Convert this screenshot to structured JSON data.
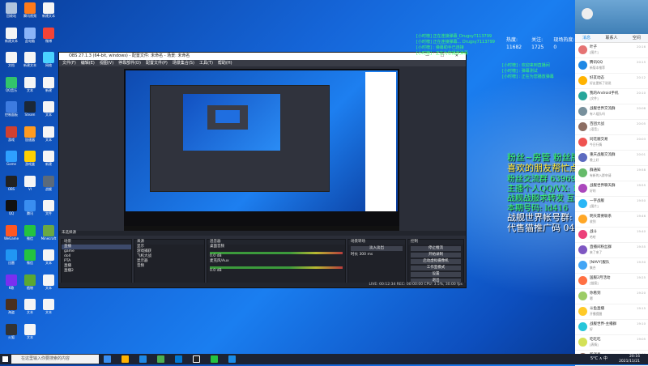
{
  "desktop_icons": [
    {
      "label": "回收站",
      "color": "#b0c4de"
    },
    {
      "label": "腾讯视频",
      "color": "#ff7a1a"
    },
    {
      "label": "新建文本",
      "color": "#f5f5f5"
    },
    {
      "label": "新建文本",
      "color": "#f5f5f5"
    },
    {
      "label": "此电脑",
      "color": "#8ab4f8"
    },
    {
      "label": "微博",
      "color": "#f44336"
    },
    {
      "label": "文档",
      "color": "#f5f5f5"
    },
    {
      "label": "新建文本",
      "color": "#f5f5f5"
    },
    {
      "label": "网络",
      "color": "#4ad2ff"
    },
    {
      "label": "QQ音乐",
      "color": "#32c46b"
    },
    {
      "label": "文本",
      "color": "#f5f5f5"
    },
    {
      "label": "新建",
      "color": "#f5f5f5"
    },
    {
      "label": "控制面板",
      "color": "#3d7be0"
    },
    {
      "label": "Steam",
      "color": "#1b2838"
    },
    {
      "label": "文本",
      "color": "#f5f5f5"
    },
    {
      "label": "游戏",
      "color": "#d04030"
    },
    {
      "label": "加速器",
      "color": "#ff9b20"
    },
    {
      "label": "文本",
      "color": "#f5f5f5"
    },
    {
      "label": "Game",
      "color": "#2ea0ff"
    },
    {
      "label": "游戏盒",
      "color": "#ffd000"
    },
    {
      "label": "新建",
      "color": "#f5f5f5"
    },
    {
      "label": "OBS",
      "color": "#222"
    },
    {
      "label": "VI",
      "color": "#f5f5f5"
    },
    {
      "label": "战舰",
      "color": "#5b6a7a"
    },
    {
      "label": "QQ",
      "color": "#111"
    },
    {
      "label": "腾讯",
      "color": "#3a8ef0"
    },
    {
      "label": "文件",
      "color": "#f5f5f5"
    },
    {
      "label": "WeGame",
      "color": "#ff5722"
    },
    {
      "label": "微信",
      "color": "#24c340"
    },
    {
      "label": "Minecraft",
      "color": "#6aa843"
    },
    {
      "label": "迅雷",
      "color": "#2196f3"
    },
    {
      "label": "微信",
      "color": "#24c340"
    },
    {
      "label": "文本",
      "color": "#f5f5f5"
    },
    {
      "label": "K歌",
      "color": "#7a2ff0"
    },
    {
      "label": "植物",
      "color": "#5aa832"
    },
    {
      "label": "文本",
      "color": "#f5f5f5"
    },
    {
      "label": "海盗",
      "color": "#4a3020"
    },
    {
      "label": "文本",
      "color": "#f5f5f5"
    },
    {
      "label": "文本",
      "color": "#f5f5f5"
    },
    {
      "label": "火狐",
      "color": "#333"
    },
    {
      "label": "文本",
      "color": "#f5f5f5"
    }
  ],
  "obs": {
    "title": "OBS 27.1.3 (64-bit, windows) - 配置文件: 未命名 - 场景: 未命名",
    "window_controls": "—  ☐  ✕",
    "menu": [
      "文件(F)",
      "编辑(E)",
      "视图(V)",
      "停靠部件(D)",
      "配置文件(P)",
      "场景集合(S)",
      "工具(T)",
      "帮助(H)"
    ],
    "source_label": "未选择源",
    "panels": {
      "scenes": {
        "header": "场景",
        "items": [
          "直播",
          "game",
          "doll",
          "PTA",
          "直播",
          "直播2"
        ]
      },
      "sources": {
        "header": "来源",
        "items": [
          "显示",
          "游戏捕获",
          "飞机大战",
          "显示器",
          "音频"
        ]
      },
      "mixer": {
        "header": "混音器",
        "channels": [
          "桌面音频",
          "麦克风/Aux"
        ],
        "levels": [
          "0.0 dB",
          "0.0 dB"
        ]
      },
      "transitions": {
        "header": "场景转场",
        "type": "淡入淡出",
        "duration_label": "时长",
        "duration": "300 ms"
      },
      "controls": {
        "header": "控制",
        "buttons": [
          "停止推流",
          "开始录制",
          "启动虚拟摄像机",
          "工作室模式",
          "设置",
          "退出"
        ]
      }
    },
    "status": "LIVE: 00:12:34   REC: 00:00:00   CPU: 3.5%, 30.00 fps"
  },
  "danmaku": [
    "[小时榜] 正在连接弹幕_Drugsy7113799",
    "[小时榜] 正在连接弹幕... Drugsy7113799",
    "[小时榜] : 弹幕助手已连接",
    "[小时榜] : 正在为您播放弹幕",
    "[小时榜] : 欢迎来到直播间",
    "[小时榜] : 弹幕测试",
    "[小时榜] : 正在为您播放弹幕"
  ],
  "stats": {
    "headers": [
      "热度:",
      "关注:",
      "现场热度:"
    ],
    "values": [
      "11682",
      "1725",
      "0"
    ]
  },
  "overlay": [
    {
      "text": "粉丝~房管   粉丝牌",
      "color": "#3dff6a",
      "size": 11
    },
    {
      "text": "喜欢的朋友帮忙点个关注 谢谢啦!",
      "color": "#ffe83d",
      "size": 11
    },
    {
      "text": "粉丝交流群 639698",
      "color": "#3dff6a",
      "size": 10
    },
    {
      "text": "主播个人QQ/VX: 18919743",
      "color": "#3dff6a",
      "size": 10
    },
    {
      "text": "战舰战服求转发 互推",
      "color": "#3dff6a",
      "size": 10
    },
    {
      "text": "本期号码: ld416",
      "color": "#3dff6a",
      "size": 10
    },
    {
      "text": "战舰世界帐号群: ",
      "color": "#ffffff",
      "size": 11
    },
    {
      "text": "代售猫推广码 0416",
      "color": "#ffffff",
      "size": 11
    }
  ],
  "qq": {
    "tabs": [
      "消息",
      "联系人",
      "空间"
    ],
    "items": [
      {
        "name": "叶子",
        "msg": "[图片]",
        "time": "20:16",
        "color": "#e57373"
      },
      {
        "name": "腾讯QQ",
        "msg": "新版本推荐",
        "time": "20:15",
        "color": "#1e88e5"
      },
      {
        "name": "好友动态",
        "msg": "好友更新了说说",
        "time": "20:12",
        "color": "#ffb300"
      },
      {
        "name": "我的Android手机",
        "msg": "[文件]",
        "time": "20:10",
        "color": "#26a69a"
      },
      {
        "name": "战舰世界交流群",
        "msg": "有人组队吗",
        "time": "20:08",
        "color": "#78909c"
      },
      {
        "name": "百团大战",
        "msg": "[语音]",
        "time": "20:05",
        "color": "#8d6e63"
      },
      {
        "name": "同花顺交易",
        "msg": "今日行情",
        "time": "20:03",
        "color": "#ef5350"
      },
      {
        "name": "重庆战舰交流群",
        "msg": "晚上好",
        "time": "20:01",
        "color": "#5c6bc0"
      },
      {
        "name": "群通知",
        "msg": "有新的入群申请",
        "time": "19:58",
        "color": "#66bb6a"
      },
      {
        "name": "战舰世界聊天群",
        "msg": "好的",
        "time": "19:55",
        "color": "#ab47bc"
      },
      {
        "name": "一字战舰",
        "msg": "[图片]",
        "time": "19:50",
        "color": "#29b6f6"
      },
      {
        "name": "明天需要联系",
        "msg": "收到",
        "time": "19:46",
        "color": "#ffa726"
      },
      {
        "name": "战斗",
        "msg": "哈哈",
        "time": "19:40",
        "color": "#ec407a"
      },
      {
        "name": "直播间粉丝群",
        "msg": "来了来了",
        "time": "19:35",
        "color": "#7e57c2"
      },
      {
        "name": "[NAVY]舰队",
        "msg": "集合",
        "time": "19:30",
        "color": "#42a5f5"
      },
      {
        "name": "国服2月活动",
        "msg": "[链接]",
        "time": "19:25",
        "color": "#ff7043"
      },
      {
        "name": "你看到",
        "msg": "嗯",
        "time": "19:20",
        "color": "#9ccc65"
      },
      {
        "name": "斗鱼直播",
        "msg": "开播提醒",
        "time": "19:15",
        "color": "#ffca28"
      },
      {
        "name": "战舰世界-主播群",
        "msg": "好",
        "time": "19:10",
        "color": "#26c6da"
      },
      {
        "name": "吃吃吃",
        "msg": "[表情]",
        "time": "19:05",
        "color": "#d4e157"
      },
      {
        "name": "新消息",
        "msg": "...",
        "time": "19:00",
        "color": "#8d6e63"
      }
    ]
  },
  "taskbar": {
    "search_placeholder": "在这里输入你要搜索的内容",
    "tray": "5°C  ∧  中  ",
    "time": "20:16",
    "date": "2021/11/21"
  }
}
